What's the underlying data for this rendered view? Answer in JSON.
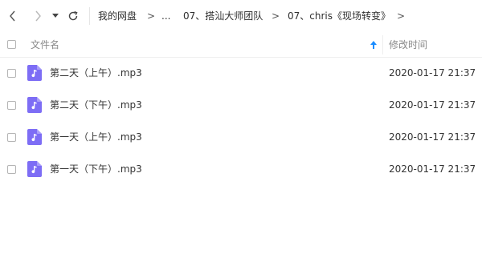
{
  "toolbar": {
    "back_icon": "chevron-left-icon",
    "forward_icon": "chevron-right-icon",
    "dropdown_icon": "caret-down-icon",
    "refresh_icon": "refresh-icon",
    "breadcrumb": [
      "我的网盘",
      "...",
      "07、搭汕大师团队",
      "07、chris《现场转变》"
    ],
    "separator": ">"
  },
  "header": {
    "name_label": "文件名",
    "time_label": "修改时间",
    "sort_icon": "sort-arrow-up-icon",
    "sort_color": "#1a8cff"
  },
  "files": [
    {
      "name": "第二天（上午）.mp3",
      "time": "2020-01-17 21:37",
      "icon": "audio-file-icon"
    },
    {
      "name": "第二天（下午）.mp3",
      "time": "2020-01-17 21:37",
      "icon": "audio-file-icon"
    },
    {
      "name": "第一天（上午）.mp3",
      "time": "2020-01-17 21:37",
      "icon": "audio-file-icon"
    },
    {
      "name": "第一天（下午）.mp3",
      "time": "2020-01-17 21:37",
      "icon": "audio-file-icon"
    }
  ],
  "colors": {
    "audio_icon": "#7d6df5",
    "text": "#333333",
    "muted_text": "#8a8a8a"
  }
}
